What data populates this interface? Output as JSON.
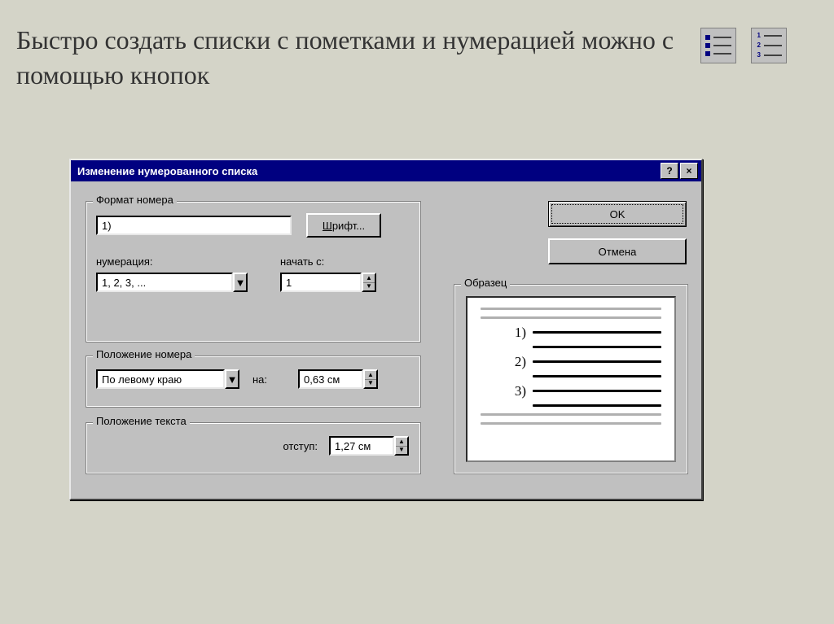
{
  "heading": "Быстро создать списки с пометками и нумерацией можно с помощью кнопок",
  "toolbar": {
    "bullets_name": "bulleted-list-icon",
    "numbers_name": "numbered-list-icon"
  },
  "dialog": {
    "title": "Изменение нумерованного списка",
    "help": "?",
    "close": "×",
    "buttons": {
      "ok": "OK",
      "cancel": "Отмена"
    },
    "format": {
      "legend": "Формат номера",
      "value": "1)",
      "font_btn": "Шрифт...",
      "font_btn_ul_char": "Ш",
      "numbering_label": "нумерация:",
      "numbering_value": "1, 2, 3, ...",
      "start_label": "начать с:",
      "start_value": "1"
    },
    "numpos": {
      "legend": "Положение номера",
      "align_value": "По левому краю",
      "at_label": "на:",
      "at_value": "0,63 см"
    },
    "txtpos": {
      "legend": "Положение текста",
      "indent_label": "отступ:",
      "indent_value": "1,27 см"
    },
    "sample": {
      "legend": "Образец",
      "items": [
        "1)",
        "2)",
        "3)"
      ]
    }
  }
}
